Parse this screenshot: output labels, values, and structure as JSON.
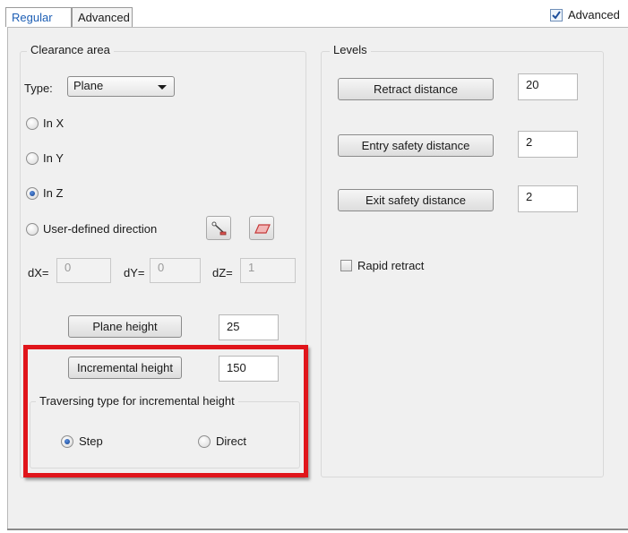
{
  "tabs": [
    {
      "label": "Regular",
      "active": true
    },
    {
      "label": "Advanced",
      "active": false
    }
  ],
  "advanced_checkbox": {
    "label": "Advanced",
    "checked": true
  },
  "clearance": {
    "title": "Clearance area",
    "type_label": "Type:",
    "type_value": "Plane",
    "directions": [
      {
        "label": "In X",
        "selected": false
      },
      {
        "label": "In Y",
        "selected": false
      },
      {
        "label": "In Z",
        "selected": true
      },
      {
        "label": "User-defined direction",
        "selected": false
      }
    ],
    "vector": {
      "dx_label": "dX=",
      "dx_value": "0",
      "dy_label": "dY=",
      "dy_value": "0",
      "dz_label": "dZ=",
      "dz_value": "1"
    },
    "plane_height_label": "Plane  height",
    "plane_height_value": "25",
    "incremental_height_label": "Incremental height",
    "incremental_height_value": "150",
    "traversing": {
      "title": "Traversing type for incremental height",
      "options": [
        {
          "label": "Step",
          "selected": true
        },
        {
          "label": "Direct",
          "selected": false
        }
      ]
    }
  },
  "levels": {
    "title": "Levels",
    "retract_label": "Retract distance",
    "retract_value": "20",
    "entry_label": "Entry safety distance",
    "entry_value": "2",
    "exit_label": "Exit safety distance",
    "exit_value": "2",
    "rapid_retract_label": "Rapid retract",
    "rapid_retract_checked": false
  },
  "colors": {
    "highlight": "#e0151b",
    "accent": "#1e5fb5",
    "panel": "#f0f0f0"
  }
}
